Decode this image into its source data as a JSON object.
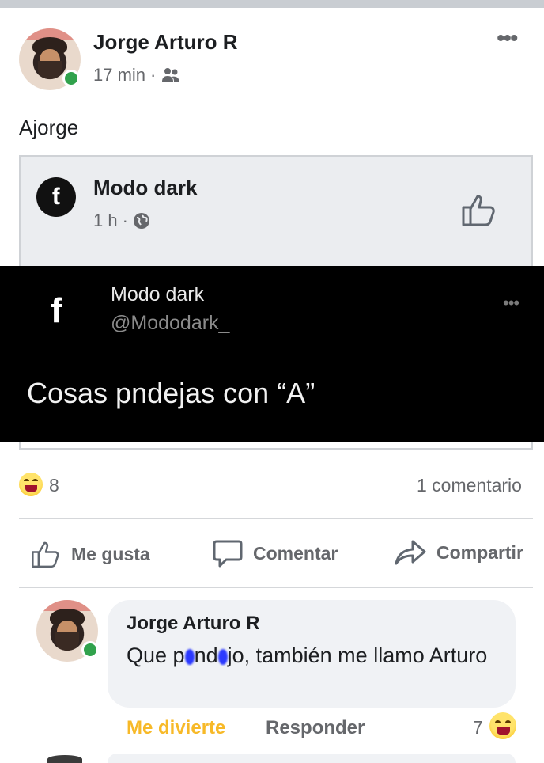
{
  "post": {
    "author": "Jorge Arturo R",
    "time": "17 min",
    "separator": "·",
    "privacy_icon": "friends-icon",
    "text": "Ajorge"
  },
  "shared_post": {
    "page_name": "Modo dark",
    "time": "1 h",
    "separator": "·",
    "privacy_icon": "globe-icon",
    "image": {
      "name": "Modo dark",
      "handle": "@Mododark_",
      "text": "Cosas pndejas con “A”"
    }
  },
  "reactions": {
    "count": "8",
    "comments": "1 comentario"
  },
  "actions": {
    "like": "Me gusta",
    "comment": "Comentar",
    "share": "Compartir"
  },
  "comment": {
    "author": "Jorge Arturo R",
    "text_start": "Que p",
    "text_mid": "nd",
    "text_end": "jo, también me llamo Arturo",
    "reaction_label": "Me divierte",
    "reply_label": "Responder",
    "reaction_count": "7"
  },
  "colors": {
    "accent_reaction": "#f7b928",
    "online": "#31a24c",
    "muted": "#65676b"
  }
}
